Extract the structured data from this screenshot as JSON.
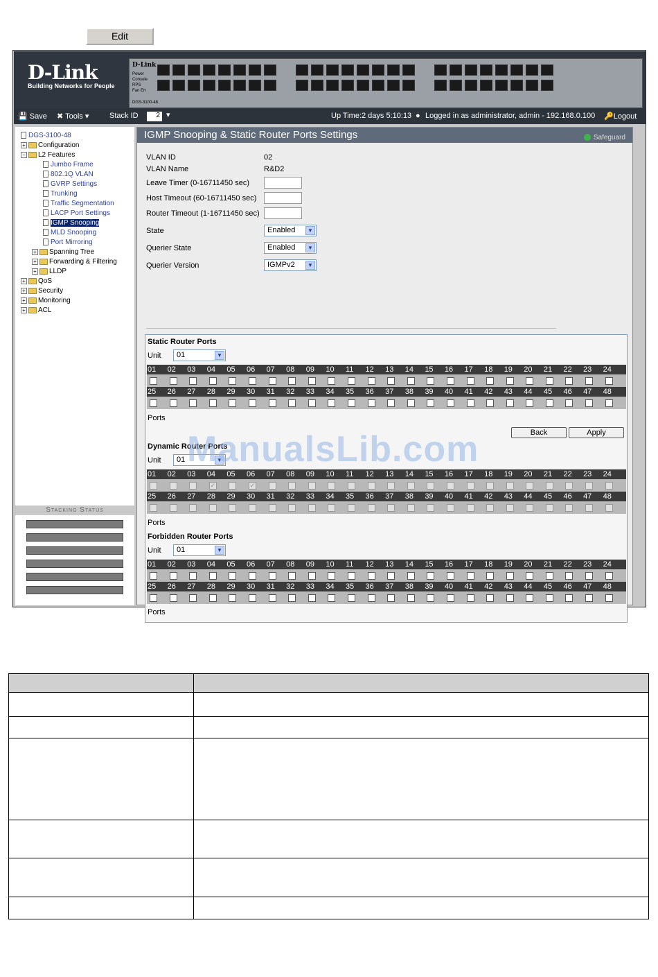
{
  "top_button": {
    "label": "Edit"
  },
  "banner": {
    "brand": "D-Link",
    "tagline": "Building Networks for People",
    "panel_label": "D-Link",
    "led_labels": [
      "Power",
      "Console",
      "RPS",
      "Fan Err"
    ],
    "model_tag": "DGS-3100-48"
  },
  "toolbar": {
    "save": "Save",
    "tools": "Tools",
    "stack_id_label": "Stack ID",
    "stack_id_value": "2",
    "status": "Up Time:2 days 5:10:13",
    "logged_in": "Logged in as administrator, admin - 192.168.0.100",
    "logout": "Logout"
  },
  "tree": {
    "root": "DGS-3100-48",
    "configuration": "Configuration",
    "l2features": "L2 Features",
    "jumbo": "Jumbo Frame",
    "vlan": "802.1Q VLAN",
    "gvrp": "GVRP Settings",
    "trunking": "Trunking",
    "traffic": "Traffic Segmentation",
    "lacp": "LACP Port Settings",
    "igmp": "IGMP Snooping",
    "mld": "MLD Snooping",
    "mirroring": "Port Mirroring",
    "spanning": "Spanning Tree",
    "forwarding": "Forwarding & Filtering",
    "lldp": "LLDP",
    "qos": "QoS",
    "security": "Security",
    "monitoring": "Monitoring",
    "acl": "ACL"
  },
  "stacking": {
    "title": "Stacking Status"
  },
  "page": {
    "title": "IGMP Snooping & Static Router Ports Settings",
    "safeguard": "Safeguard"
  },
  "form": {
    "vlan_id_label": "VLAN ID",
    "vlan_id_value": "02",
    "vlan_name_label": "VLAN Name",
    "vlan_name_value": "R&D2",
    "leave_timer_label": "Leave Timer (0-16711450 sec)",
    "host_timeout_label": "Host Timeout (60-16711450 sec)",
    "router_timeout_label": "Router Timeout (1-16711450 sec)",
    "state_label": "State",
    "state_value": "Enabled",
    "querier_state_label": "Querier State",
    "querier_state_value": "Enabled",
    "querier_version_label": "Querier Version",
    "querier_version_value": "IGMPv2"
  },
  "sections": {
    "static": {
      "title": "Static Router Ports",
      "unit_label": "Unit",
      "unit_value": "01",
      "ports_label": "Ports"
    },
    "dynamic": {
      "title": "Dynamic Router Ports",
      "unit_label": "Unit",
      "unit_value": "01",
      "ports_label": "Ports"
    },
    "forbidden": {
      "title": "Forbidden Router Ports",
      "unit_label": "Unit",
      "unit_value": "01",
      "ports_label": "Ports"
    }
  },
  "ports_row1": [
    "01",
    "02",
    "03",
    "04",
    "05",
    "06",
    "07",
    "08",
    "09",
    "10",
    "11",
    "12",
    "13",
    "14",
    "15",
    "16",
    "17",
    "18",
    "19",
    "20",
    "21",
    "22",
    "23",
    "24"
  ],
  "ports_row2": [
    "25",
    "26",
    "27",
    "28",
    "29",
    "30",
    "31",
    "32",
    "33",
    "34",
    "35",
    "36",
    "37",
    "38",
    "39",
    "40",
    "41",
    "42",
    "43",
    "44",
    "45",
    "46",
    "47",
    "48"
  ],
  "dynamic_checked": [
    "04",
    "06"
  ],
  "buttons": {
    "back": "Back",
    "apply": "Apply"
  },
  "watermark": "ManualsLib.com"
}
